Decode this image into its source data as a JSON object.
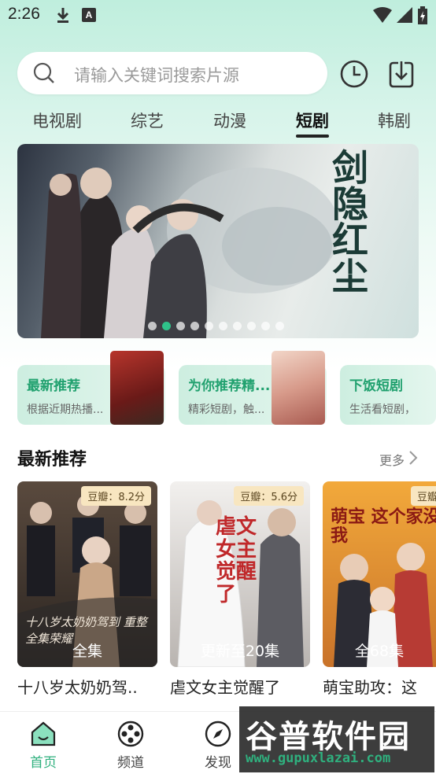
{
  "status": {
    "time": "2:26"
  },
  "search": {
    "placeholder": "请输入关键词搜索片源"
  },
  "tabs": [
    {
      "label": "电视剧"
    },
    {
      "label": "综艺"
    },
    {
      "label": "动漫"
    },
    {
      "label": "短剧",
      "active": true
    },
    {
      "label": "韩剧"
    }
  ],
  "banner": {
    "title": "剑隐红尘",
    "slide_count": 10,
    "active_slide": 2
  },
  "features": [
    {
      "title": "最新推荐",
      "subtitle": "根据近期热播..."
    },
    {
      "title": "为你推荐精...",
      "subtitle": "精彩短剧，触..."
    },
    {
      "title": "下饭短剧",
      "subtitle": "生活看短剧，"
    }
  ],
  "section": {
    "title": "最新推荐",
    "more": "更多"
  },
  "posters": [
    {
      "rating": "豆瓣：8.2分",
      "episodes": "全集",
      "title": "十八岁太奶奶驾..",
      "art_text": "十八岁太奶奶驾到 重整全集荣耀",
      "colors": [
        "#5a4a3e",
        "#2a2420"
      ]
    },
    {
      "rating": "豆瓣：5.6分",
      "episodes": "更新至20集",
      "title": "虐文女主觉醒了",
      "art_text": "虐文女主觉醒了",
      "colors": [
        "#e9e6e4",
        "#8e8a88"
      ]
    },
    {
      "rating": "豆瓣",
      "episodes": "全68集",
      "title": "萌宝助攻：这",
      "art_text": "萌宝 这个家没我",
      "colors": [
        "#f2a93b",
        "#c9732a"
      ]
    }
  ],
  "nav": [
    {
      "label": "首页",
      "icon": "home-icon",
      "active": true
    },
    {
      "label": "频道",
      "icon": "film-reel-icon"
    },
    {
      "label": "发现",
      "icon": "compass-icon"
    }
  ],
  "watermark": {
    "main": "谷普软件园",
    "url": "www.gupuxlazai.com"
  },
  "colors": {
    "accent": "#2fb07e",
    "feature_title": "#21a16f",
    "rating_bg": "#f8e6c0"
  }
}
